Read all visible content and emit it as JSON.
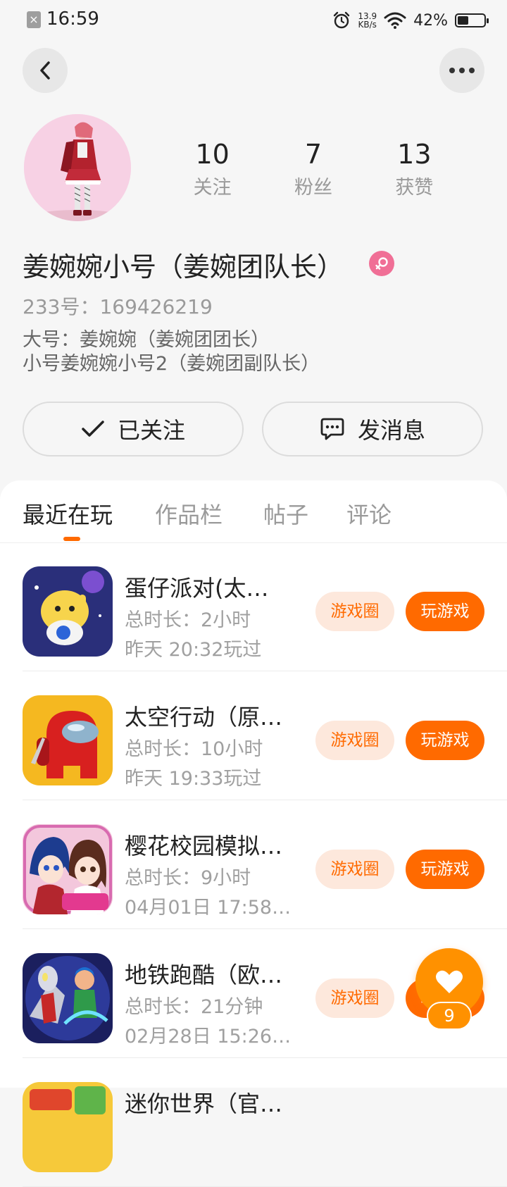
{
  "status_bar": {
    "time": "16:59",
    "net_speed_value": "13.9",
    "net_speed_unit": "KB/s",
    "battery_percent": "42%",
    "battery_level": 0.42
  },
  "profile": {
    "stats": [
      {
        "value": "10",
        "label": "关注"
      },
      {
        "value": "7",
        "label": "粉丝"
      },
      {
        "value": "13",
        "label": "获赞"
      }
    ],
    "name": "姜婉婉小号（姜婉团队长）",
    "account_id": "233号：169426219",
    "bio_lines": [
      "大号：姜婉婉（姜婉团团长）",
      "小号姜婉婉小号2（姜婉团副队长）"
    ],
    "gender_icon": "female-icon"
  },
  "actions": {
    "follow_label": "已关注",
    "message_label": "发消息"
  },
  "tabs": [
    {
      "label": "最近在玩",
      "active": true
    },
    {
      "label": "作品栏",
      "active": false
    },
    {
      "label": "帖子",
      "active": false
    },
    {
      "label": "评论",
      "active": false
    }
  ],
  "games": [
    {
      "name": "蛋仔派对(太…",
      "duration": "总时长：2小时",
      "last_played": "昨天 20:32玩过",
      "circle_label": "游戏圈",
      "play_label": "玩游戏"
    },
    {
      "name": "太空行动（原…",
      "duration": "总时长：10小时",
      "last_played": "昨天 19:33玩过",
      "circle_label": "游戏圈",
      "play_label": "玩游戏"
    },
    {
      "name": "樱花校园模拟…",
      "duration": "总时长：9小时",
      "last_played": "04月01日 17:58…",
      "circle_label": "游戏圈",
      "play_label": "玩游戏"
    },
    {
      "name": "地铁跑酷（欧…",
      "duration": "总时长：21分钟",
      "last_played": "02月28日 15:26…",
      "circle_label": "游戏圈",
      "play_label": "玩游戏"
    },
    {
      "name": "迷你世界（官…",
      "duration": "",
      "last_played": "",
      "circle_label": "",
      "play_label": ""
    }
  ],
  "floating_like": {
    "count": "9"
  },
  "colors": {
    "accent": "#ff6a00",
    "accent_light": "#fde8dc",
    "like_bubble": "#ff9100",
    "female_badge": "#f06f96"
  }
}
